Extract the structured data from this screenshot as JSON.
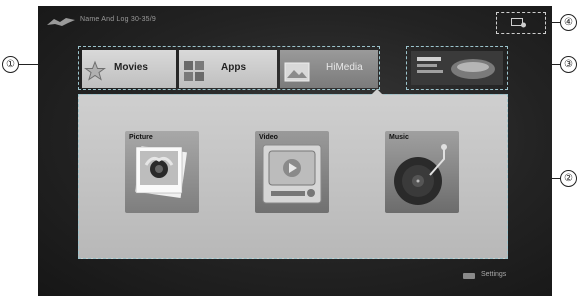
{
  "status_bar": {
    "text": "Name And Log  30-35/9"
  },
  "tabs": [
    {
      "label": "Movies"
    },
    {
      "label": "Apps"
    },
    {
      "label": "HiMedia"
    }
  ],
  "media": [
    {
      "label": "Picture"
    },
    {
      "label": "Video"
    },
    {
      "label": "Music"
    }
  ],
  "settings": {
    "label": "Settings"
  },
  "callouts": [
    "①",
    "②",
    "③",
    "④"
  ],
  "colors": {
    "screen_bg": "#1f1f1f",
    "panel": "#c4c4c4",
    "dashed_outline": "#9cc4cc"
  }
}
